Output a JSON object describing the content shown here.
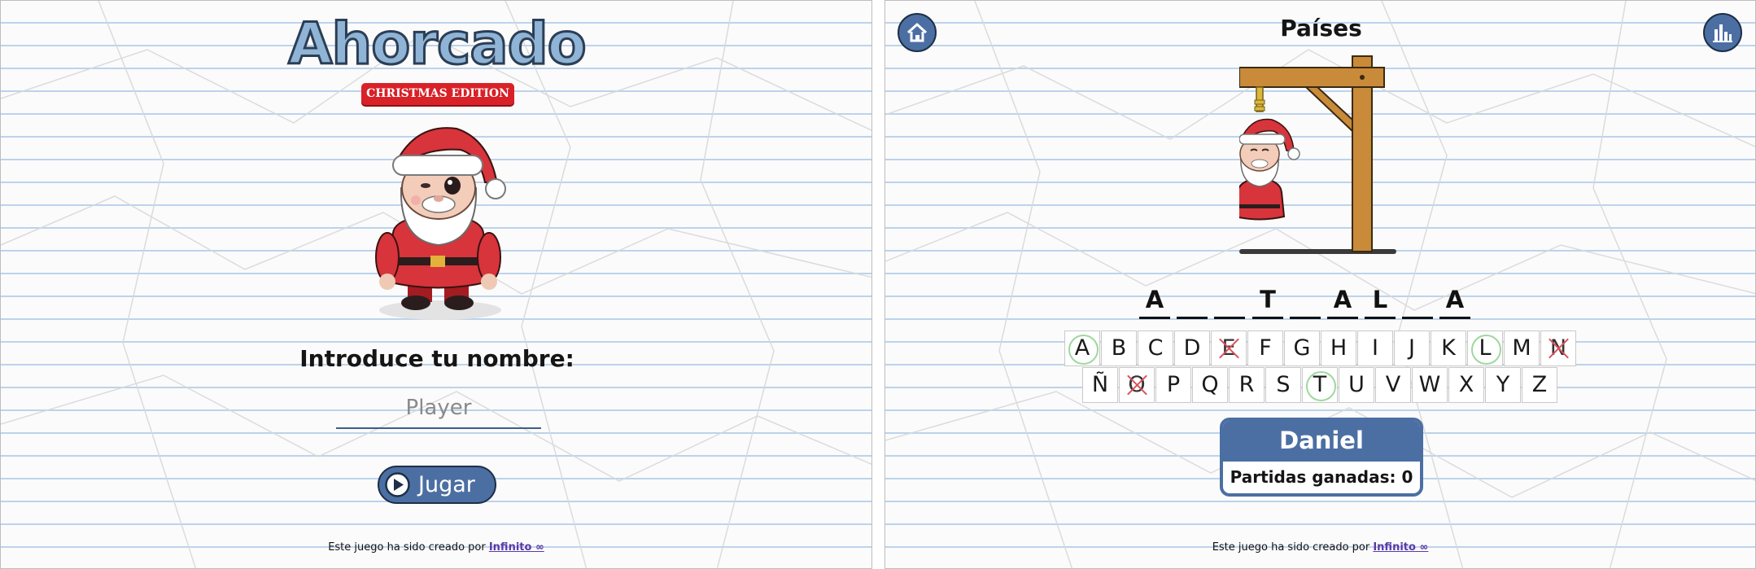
{
  "left": {
    "logo_title": "Ahorcado",
    "edition_badge": "CHRISTMAS EDITION",
    "name_prompt": "Introduce tu nombre:",
    "name_input_placeholder": "Player",
    "play_button_label": "Jugar"
  },
  "right": {
    "category": "Países",
    "word_slots": [
      "A",
      "",
      "",
      "T",
      "",
      "A",
      "L",
      "",
      "A"
    ],
    "keyboard": {
      "row1": [
        {
          "letter": "A",
          "state": "correct"
        },
        {
          "letter": "B",
          "state": "unused"
        },
        {
          "letter": "C",
          "state": "unused"
        },
        {
          "letter": "D",
          "state": "unused"
        },
        {
          "letter": "E",
          "state": "wrong"
        },
        {
          "letter": "F",
          "state": "unused"
        },
        {
          "letter": "G",
          "state": "unused"
        },
        {
          "letter": "H",
          "state": "unused"
        },
        {
          "letter": "I",
          "state": "unused"
        },
        {
          "letter": "J",
          "state": "unused"
        },
        {
          "letter": "K",
          "state": "unused"
        },
        {
          "letter": "L",
          "state": "correct"
        },
        {
          "letter": "M",
          "state": "unused"
        },
        {
          "letter": "N",
          "state": "wrong"
        }
      ],
      "row2": [
        {
          "letter": "Ñ",
          "state": "unused"
        },
        {
          "letter": "O",
          "state": "wrong"
        },
        {
          "letter": "P",
          "state": "unused"
        },
        {
          "letter": "Q",
          "state": "unused"
        },
        {
          "letter": "R",
          "state": "unused"
        },
        {
          "letter": "S",
          "state": "unused"
        },
        {
          "letter": "T",
          "state": "correct"
        },
        {
          "letter": "U",
          "state": "unused"
        },
        {
          "letter": "V",
          "state": "unused"
        },
        {
          "letter": "W",
          "state": "unused"
        },
        {
          "letter": "X",
          "state": "unused"
        },
        {
          "letter": "Y",
          "state": "unused"
        },
        {
          "letter": "Z",
          "state": "unused"
        }
      ]
    },
    "player_name": "Daniel",
    "wins_label": "Partidas ganadas: 0",
    "home_icon": "home-icon",
    "stats_icon": "bar-chart-icon"
  },
  "footer": {
    "text": "Este juego ha sido creado por ",
    "link_text": "Infinito ∞"
  },
  "colors": {
    "accent": "#4c6fa3",
    "badge": "#d92128",
    "correct": "#9ed89e",
    "wrong": "#d9515b"
  }
}
